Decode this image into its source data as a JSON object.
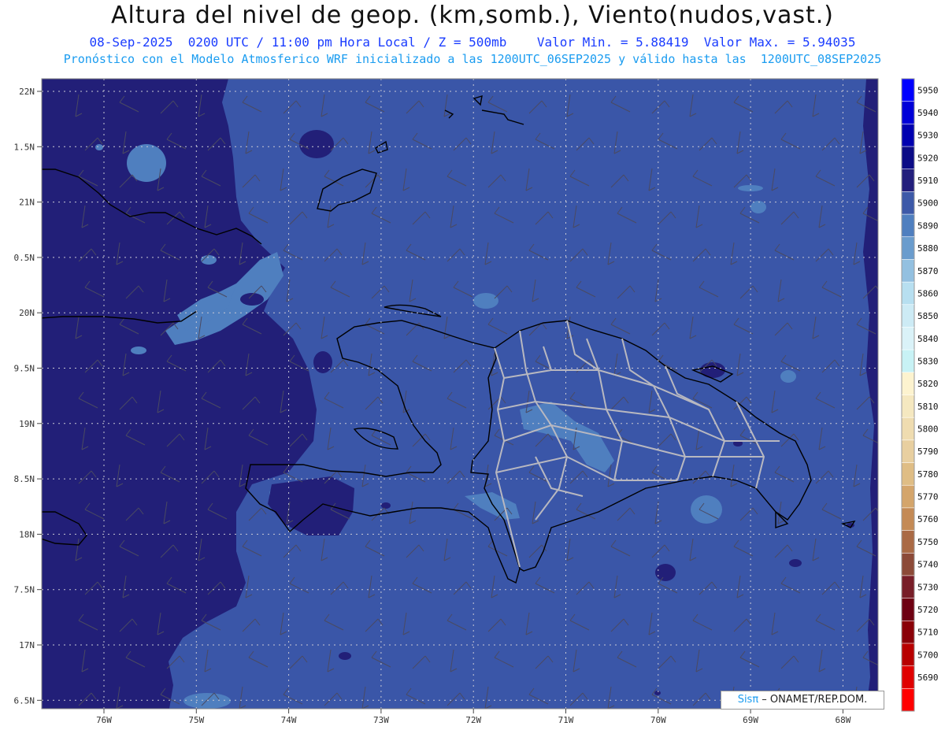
{
  "header": {
    "title": "Altura del nivel de geop. (km,somb.), Viento(nudos,vast.)",
    "subtitle": "08-Sep-2025  0200 UTC / 11:00 pm Hora Local / Z = 500mb    Valor Min. = 5.88419  Valor Max. = 5.94035",
    "model_line": "Pronóstico con el Modelo Atmosferico WRF inicializado a las 1200UTC_06SEP2025 y válido hasta las  1200UTC_08SEP2025"
  },
  "axes": {
    "lat_labels": [
      "22N",
      "1.5N",
      "21N",
      "0.5N",
      "20N",
      "9.5N",
      "19N",
      "8.5N",
      "18N",
      "7.5N",
      "17N",
      "6.5N"
    ],
    "lon_labels": [
      "76W",
      "75W",
      "74W",
      "73W",
      "72W",
      "71W",
      "70W",
      "69W",
      "68W"
    ]
  },
  "colorbar": {
    "levels": [
      5950,
      5940,
      5930,
      5920,
      5910,
      5900,
      5890,
      5880,
      5870,
      5860,
      5850,
      5840,
      5830,
      5820,
      5810,
      5800,
      5790,
      5780,
      5770,
      5760,
      5750,
      5740,
      5730,
      5720,
      5710,
      5700,
      5690
    ],
    "colors": [
      "#0000ff",
      "#0000d8",
      "#0000b0",
      "#0c0c86",
      "#231f7c",
      "#3d59a8",
      "#4f7fbf",
      "#6a9ccd",
      "#93c0e0",
      "#b7dff0",
      "#cdebf5",
      "#daf2f8",
      "#c8f2f5",
      "#fdf3cf",
      "#f5e8c0",
      "#efdcb0",
      "#e8cfa0",
      "#dfbd85",
      "#d4a56b",
      "#c48a55",
      "#aa6a45",
      "#8c4a38",
      "#781e28",
      "#6e0012",
      "#8a0008",
      "#b80000",
      "#e00000",
      "#ff0000"
    ]
  },
  "field_colors": {
    "sea_dark": "#221f78",
    "main": "#3a56a8",
    "light": "#4f7fbf",
    "lighter": "#6a9ccd"
  },
  "credit": {
    "brand": "Sisπ",
    "text": " – ONAMET/REP.DOM."
  }
}
